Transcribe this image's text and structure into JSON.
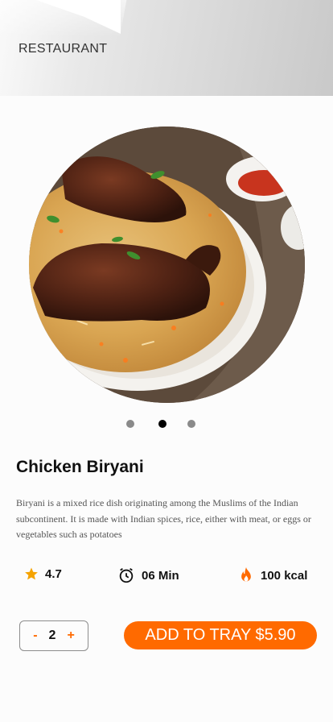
{
  "header": {
    "brand": "RESTAURANT"
  },
  "carousel": {
    "image_alt": "Chicken Biryani plate",
    "dots": 3,
    "active_index": 1
  },
  "item": {
    "name": "Chicken Biryani",
    "description": "Biryani is a mixed rice dish originating among the Muslims of the Indian subcontinent. It is made with Indian spices, rice, either with meat, or eggs or vegetables such as potatoes"
  },
  "stats": {
    "rating": "4.7",
    "time": "06 Min",
    "calories": "100 kcal",
    "icons": [
      "star-icon",
      "alarm-clock-icon",
      "flame-icon"
    ]
  },
  "order": {
    "minus": "-",
    "quantity": "2",
    "plus": "+",
    "cta_label": "ADD TO TRAY $5.90"
  },
  "colors": {
    "accent": "#ff6a00",
    "star": "#f5a300",
    "dot_active": "#000000",
    "dot_inactive": "#8a8a8a"
  }
}
